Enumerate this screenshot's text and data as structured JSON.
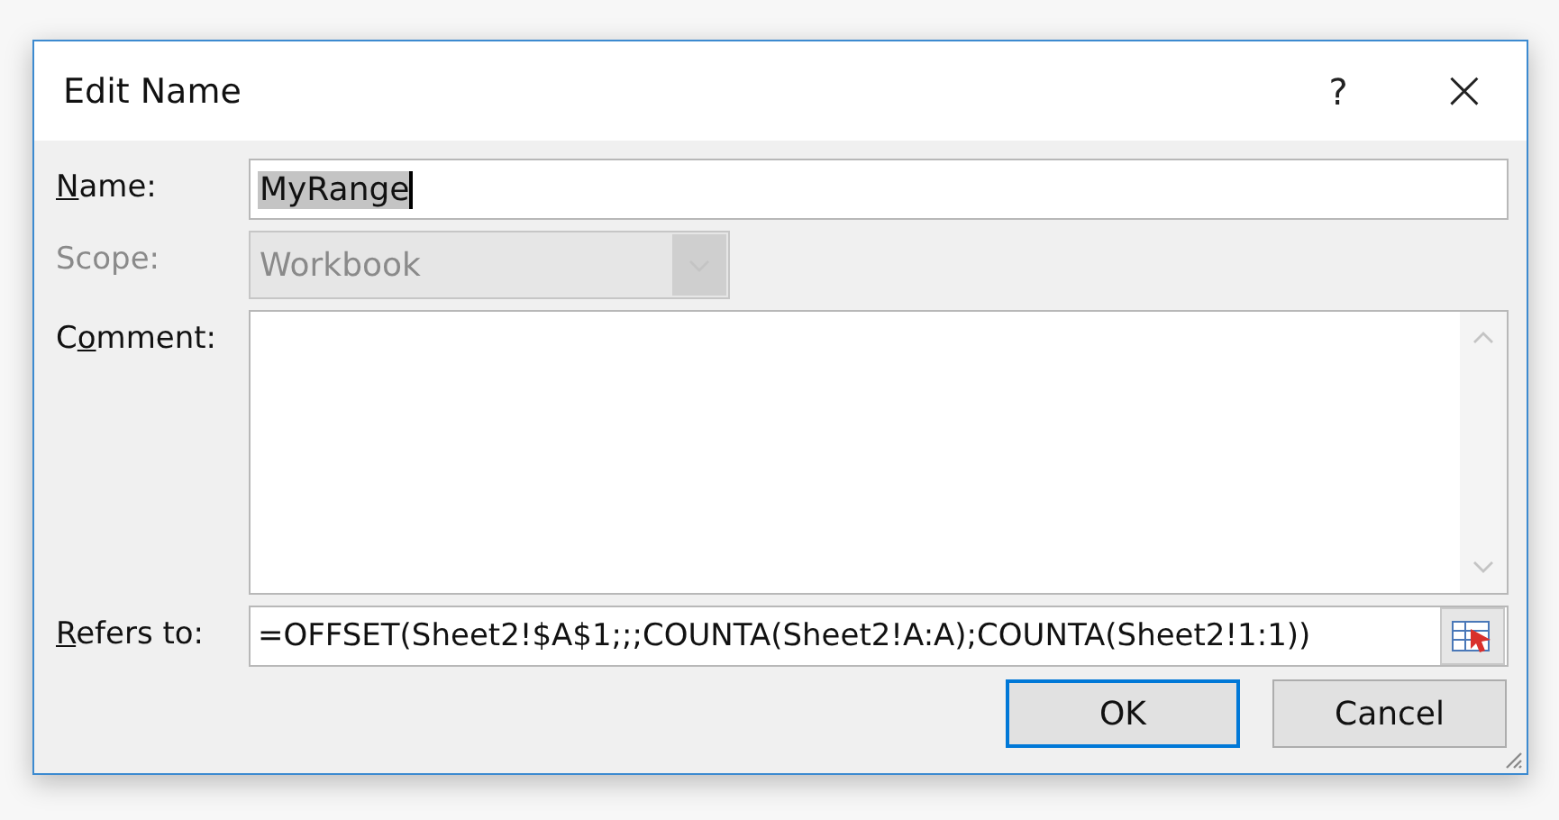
{
  "window": {
    "title": "Edit Name",
    "help": "?",
    "close": "×"
  },
  "fields": [
    {
      "kind": "text",
      "label": {
        "key": "N",
        "post": "ame:"
      },
      "value": "MyRange",
      "highlighted": true,
      "disabled": false
    },
    {
      "kind": "dropdown",
      "label": {
        "pre": "Scope:"
      },
      "value": "Workbook",
      "disabled": true
    },
    {
      "kind": "textarea",
      "label": {
        "pre": "C",
        "key": "o",
        "post": "mment:"
      },
      "disabled": false
    },
    {
      "kind": "reference",
      "label": {
        "key": "R",
        "post": "efers to:"
      },
      "value": "=OFFSET(Sheet2!$A$1;;;COUNTA(Sheet2!A:A);COUNTA(Sheet2!1:1))",
      "disabled": false
    }
  ],
  "buttons": [
    {
      "label": "OK",
      "default": true
    },
    {
      "label": "Cancel",
      "default": false
    }
  ]
}
